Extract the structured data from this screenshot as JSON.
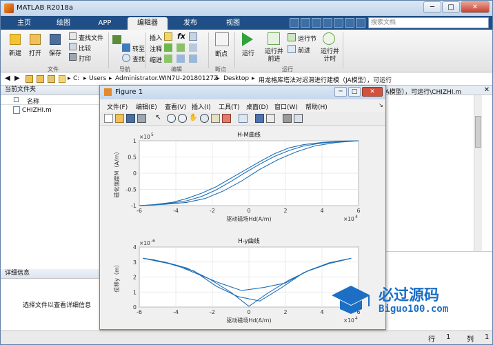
{
  "app": {
    "title": "MATLAB R2018a"
  },
  "tabs": [
    "主页",
    "绘图",
    "APP",
    "编辑器",
    "发布",
    "视图"
  ],
  "active_tab": 3,
  "search": {
    "placeholder": "搜索文档"
  },
  "ribbon": {
    "file": {
      "new": "新建",
      "open": "打开",
      "save": "保存",
      "find_files": "查找文件",
      "compare": "比较",
      "print": "打印",
      "group": "文件"
    },
    "nav": {
      "goto": "转至",
      "find": "查找",
      "group": "导航"
    },
    "edit": {
      "insert": "插入",
      "comment": "注释",
      "indent": "缩进",
      "fx": "fx",
      "group": "编辑"
    },
    "breakpoint": {
      "label": "断点",
      "group": "断点"
    },
    "run": {
      "run": "运行",
      "run_advance": "运行并\n前进",
      "run_section": "运行节",
      "advance": "前进",
      "run_time": "运行并\n计时",
      "group": "运行"
    }
  },
  "address": {
    "parts": [
      "C:",
      "Users",
      "Administrator.WIN7U-20180127Z",
      "Desktop",
      "用龙格库塔法对迟滞进行建模（JA模型），可运行"
    ]
  },
  "current_folder": {
    "title": "当前文件夹",
    "col_name": "名称",
    "files": [
      "CHIZHI.m"
    ]
  },
  "details": {
    "title": "详细信息",
    "hint": "选择文件以查看详细信息"
  },
  "right_panel": {
    "header_text": "JA模型），可运行\\CHIZHI.m"
  },
  "status": {
    "row_label": "行",
    "row": "1",
    "col_label": "列",
    "col": "1"
  },
  "figure": {
    "title": "Figure 1",
    "menu": [
      "文件(F)",
      "编辑(E)",
      "查看(V)",
      "插入(I)",
      "工具(T)",
      "桌面(D)",
      "窗口(W)",
      "帮助(H)"
    ]
  },
  "chart_data": [
    {
      "type": "line",
      "title": "H-M曲线",
      "xlabel": "驱动磁场H_d(A/m)",
      "ylabel": "磁化强度M（A/m）",
      "x_multiplier": "×10^4",
      "y_multiplier": "×10^5",
      "xlim": [
        -6,
        6
      ],
      "ylim": [
        -1,
        1
      ],
      "xticks": [
        "-6",
        "-4",
        "-2",
        "0",
        "2",
        "4",
        "6"
      ],
      "yticks": [
        "-1",
        "-0.5",
        "0",
        "0.5",
        "1"
      ],
      "grid": true,
      "series": [
        {
          "x": [
            -6,
            -5.2,
            -4.2,
            -3.4,
            -2.6,
            -1.8,
            -1.0,
            -0.2,
            0.6,
            1.4,
            2.2,
            3.0,
            4.0,
            5.2,
            6
          ],
          "y": [
            -1,
            -0.98,
            -0.92,
            -0.85,
            -0.72,
            -0.52,
            -0.26,
            0.02,
            0.28,
            0.52,
            0.7,
            0.84,
            0.93,
            0.98,
            1
          ]
        },
        {
          "x": [
            6,
            5.0,
            4.0,
            3.0,
            2.2,
            1.4,
            0.6,
            -0.2,
            -1.0,
            -1.8,
            -2.6,
            -3.4,
            -4.2,
            -5.2,
            -6
          ],
          "y": [
            1,
            0.99,
            0.95,
            0.88,
            0.78,
            0.6,
            0.36,
            0.1,
            -0.16,
            -0.42,
            -0.62,
            -0.78,
            -0.9,
            -0.97,
            -1
          ]
        },
        {
          "x": [
            -6,
            -4.6,
            -3.4,
            -2.4,
            -1.4,
            -0.4,
            0.6,
            1.6,
            2.6,
            3.6,
            4.8,
            6
          ],
          "y": [
            -1,
            -0.96,
            -0.9,
            -0.78,
            -0.55,
            -0.24,
            0.12,
            0.42,
            0.66,
            0.84,
            0.95,
            1
          ]
        }
      ]
    },
    {
      "type": "line",
      "title": "H-y曲线",
      "xlabel": "驱动磁场H_d(A/m)",
      "ylabel": "位移y（m）",
      "x_multiplier": "×10^4",
      "y_multiplier": "×10^-6",
      "xlim": [
        -6,
        6
      ],
      "ylim": [
        0,
        4
      ],
      "xticks": [
        "-6",
        "-4",
        "-2",
        "0",
        "2",
        "4",
        "6"
      ],
      "yticks": [
        "0",
        "1",
        "2",
        "3",
        "4"
      ],
      "grid": true,
      "series": [
        {
          "x": [
            -5.8,
            -4.6,
            -3.4,
            -2.2,
            -1.0,
            0,
            1.0,
            2.2,
            3.4,
            4.6,
            5.6
          ],
          "y": [
            3.25,
            3.0,
            2.6,
            1.9,
            1.0,
            0.05,
            0.9,
            1.8,
            2.5,
            3.0,
            3.25
          ]
        },
        {
          "x": [
            5.6,
            4.4,
            3.2,
            2.0,
            0.8,
            -0.4,
            -1.6,
            -2.8,
            -4.0,
            -5.2,
            -5.8
          ],
          "y": [
            3.25,
            2.95,
            2.4,
            1.6,
            1.3,
            1.1,
            1.6,
            2.2,
            2.8,
            3.15,
            3.25
          ]
        },
        {
          "x": [
            -5.8,
            -4.4,
            -3.0,
            -1.8,
            -0.6,
            0.6,
            1.8,
            3.0,
            4.4,
            5.6
          ],
          "y": [
            3.25,
            2.9,
            2.4,
            1.4,
            0.7,
            0.4,
            1.3,
            2.3,
            2.9,
            3.25
          ]
        }
      ]
    }
  ],
  "watermark": {
    "title": "必过源码",
    "url": "Biguo100.com"
  }
}
